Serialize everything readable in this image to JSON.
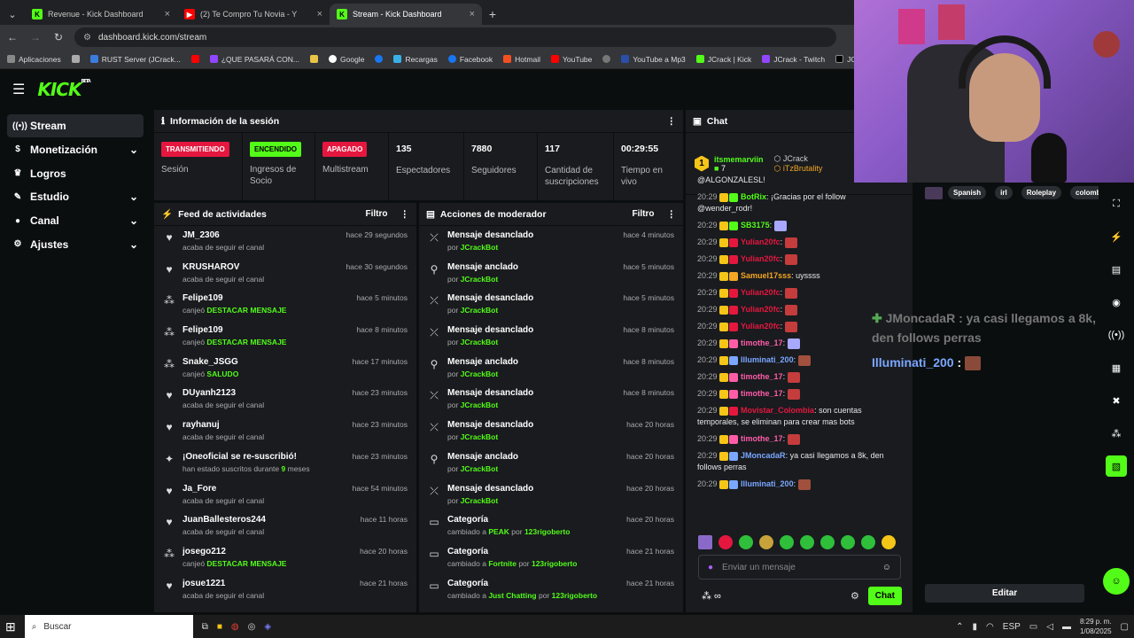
{
  "browser": {
    "tabs": [
      {
        "title": "Revenue - Kick Dashboard",
        "icon": "kick"
      },
      {
        "title": "(2) Te Compro Tu Novia - Y",
        "icon": "youtube"
      },
      {
        "title": "Stream - Kick Dashboard",
        "icon": "kick",
        "active": true
      }
    ],
    "url": "dashboard.kick.com/stream",
    "bookmarks": [
      "Aplicaciones",
      "RUST Server (JCrack...",
      "¿QUE PASARÁ CON...",
      "Google",
      "Recargas",
      "Facebook",
      "Hotmail",
      "YouTube",
      "YouTube a Mp3",
      "JCrack | Kick",
      "JCrack - Twitch",
      "JCrack (@J"
    ]
  },
  "logo": "KICK",
  "logo_sup": "BETA",
  "sidebar": {
    "items": [
      {
        "label": "Stream",
        "icon": "broadcast-icon",
        "active": true
      },
      {
        "label": "Monetización",
        "icon": "dollar-icon",
        "chevron": true
      },
      {
        "label": "Logros",
        "icon": "trophy-icon"
      },
      {
        "label": "Estudio",
        "icon": "pencil-icon",
        "chevron": true
      },
      {
        "label": "Canal",
        "icon": "user-icon",
        "chevron": true
      },
      {
        "label": "Ajustes",
        "icon": "gear-icon",
        "chevron": true
      }
    ]
  },
  "session": {
    "title": "Información de la sesión",
    "stats": [
      {
        "badge": "TRANSMITIENDO",
        "color": "red",
        "label": "Sesión"
      },
      {
        "badge": "ENCENDIDO",
        "color": "green",
        "label": "Ingresos de Socio"
      },
      {
        "badge": "APAGADO",
        "color": "red",
        "label": "Multistream"
      },
      {
        "value": "135",
        "label": "Espectadores"
      },
      {
        "value": "7880",
        "label": "Seguidores"
      },
      {
        "value": "117",
        "label": "Cantidad de suscripciones"
      },
      {
        "value": "00:29:55",
        "label": "Tiempo en vivo"
      }
    ]
  },
  "feed": {
    "title": "Feed de actividades",
    "filter": "Filtro",
    "items": [
      {
        "icon": "heart",
        "name": "JM_2306",
        "sub": "acaba de seguir el canal",
        "time": "hace 29 segundos"
      },
      {
        "icon": "heart",
        "name": "KRUSHAROV",
        "sub": "acaba de seguir el canal",
        "time": "hace 30 segundos"
      },
      {
        "icon": "points",
        "name": "Felipe109",
        "sub": "canjeó ",
        "hl": "DESTACAR MENSAJE",
        "time": "hace 5 minutos"
      },
      {
        "icon": "points",
        "name": "Felipe109",
        "sub": "canjeó ",
        "hl": "DESTACAR MENSAJE",
        "time": "hace 8 minutos"
      },
      {
        "icon": "points",
        "name": "Snake_JSGG",
        "sub": "canjeó ",
        "hl": "SALUDO",
        "time": "hace 17 minutos"
      },
      {
        "icon": "heart",
        "name": "DUyanh2123",
        "sub": "acaba de seguir el canal",
        "time": "hace 23 minutos"
      },
      {
        "icon": "heart",
        "name": "rayhanuj",
        "sub": "acaba de seguir el canal",
        "time": "hace 23 minutos"
      },
      {
        "icon": "star",
        "name": "¡Oneoficial se re-suscribió!",
        "sub": "han estado suscritos durante ",
        "hl": "9",
        "sub2": " meses",
        "time": "hace 23 minutos"
      },
      {
        "icon": "heart",
        "name": "Ja_Fore",
        "sub": "acaba de seguir el canal",
        "time": "hace 54 minutos"
      },
      {
        "icon": "heart",
        "name": "JuanBallesteros244",
        "sub": "acaba de seguir el canal",
        "time": "hace 11 horas"
      },
      {
        "icon": "points",
        "name": "josego212",
        "sub": "canjeó ",
        "hl": "DESTACAR MENSAJE",
        "time": "hace 20 horas"
      },
      {
        "icon": "heart",
        "name": "josue1221",
        "sub": "acaba de seguir el canal",
        "time": "hace 21 horas"
      }
    ]
  },
  "moderator": {
    "title": "Acciones de moderador",
    "filter": "Filtro",
    "items": [
      {
        "icon": "unpin",
        "name": "Mensaje desanclado",
        "sub": "por ",
        "hl": "JCrackBot",
        "time": "hace 4 minutos"
      },
      {
        "icon": "pin",
        "name": "Mensaje anclado",
        "sub": "por ",
        "hl": "JCrackBot",
        "time": "hace 5 minutos"
      },
      {
        "icon": "unpin",
        "name": "Mensaje desanclado",
        "sub": "por ",
        "hl": "JCrackBot",
        "time": "hace 5 minutos"
      },
      {
        "icon": "unpin",
        "name": "Mensaje desanclado",
        "sub": "por ",
        "hl": "JCrackBot",
        "time": "hace 8 minutos"
      },
      {
        "icon": "pin",
        "name": "Mensaje anclado",
        "sub": "por ",
        "hl": "JCrackBot",
        "time": "hace 8 minutos"
      },
      {
        "icon": "unpin",
        "name": "Mensaje desanclado",
        "sub": "por ",
        "hl": "JCrackBot",
        "time": "hace 8 minutos"
      },
      {
        "icon": "unpin",
        "name": "Mensaje desanclado",
        "sub": "por ",
        "hl": "JCrackBot",
        "time": "hace 20 horas"
      },
      {
        "icon": "pin",
        "name": "Mensaje anclado",
        "sub": "por ",
        "hl": "JCrackBot",
        "time": "hace 20 horas"
      },
      {
        "icon": "unpin",
        "name": "Mensaje desanclado",
        "sub": "por ",
        "hl": "JCrackBot",
        "time": "hace 20 horas"
      },
      {
        "icon": "category",
        "name": "Categoría",
        "sub": "cambiado a ",
        "hl": "PEAK",
        "sub2": " por ",
        "hl2": "123rigoberto",
        "time": "hace 20 horas"
      },
      {
        "icon": "category",
        "name": "Categoría",
        "sub": "cambiado a ",
        "hl": "Fortnite",
        "sub2": " por ",
        "hl2": "123rigoberto",
        "time": "hace 21 horas"
      },
      {
        "icon": "category",
        "name": "Categoría",
        "sub": "cambiado a ",
        "hl": "Just Chatting",
        "sub2": " por ",
        "hl2": "123rigoberto",
        "time": "hace 21 horas"
      }
    ]
  },
  "chat": {
    "title": "Chat",
    "pinned": {
      "rank": "1",
      "user": "itsmemarviin",
      "count": "7",
      "user2": "JCrack",
      "user3": "iTzBrutality"
    },
    "messages": [
      {
        "text": "@ALGONZALESL!"
      },
      {
        "time": "20:29",
        "user": "BotRix",
        "color": "#53fc18",
        "text": ": ¡Gracias por el follow @wender_rodr!"
      },
      {
        "time": "20:29",
        "user": "SB3175",
        "color": "#53fc18",
        "text": ":",
        "emote": "drop"
      },
      {
        "time": "20:29",
        "user": "Yulian20fc",
        "color": "#e5173f",
        "text": ":",
        "emote": "red"
      },
      {
        "time": "20:29",
        "user": "Yulian20fc",
        "color": "#e5173f",
        "text": ":",
        "emote": "red"
      },
      {
        "time": "20:29",
        "user": "Samuel17sss",
        "color": "#f5a623",
        "text": ": uyssss"
      },
      {
        "time": "20:29",
        "user": "Yulian20fc",
        "color": "#e5173f",
        "text": ":",
        "emote": "red"
      },
      {
        "time": "20:29",
        "user": "Yulian20fc",
        "color": "#e5173f",
        "text": ":",
        "emote": "red"
      },
      {
        "time": "20:29",
        "user": "Yulian20fc",
        "color": "#e5173f",
        "text": ":",
        "emote": "red"
      },
      {
        "time": "20:29",
        "user": "timothe_17",
        "color": "#ff5ca8",
        "text": ":",
        "emote": "drop"
      },
      {
        "time": "20:29",
        "user": "Illuminati_200",
        "color": "#7aa7ff",
        "text": ":",
        "emote": "face"
      },
      {
        "time": "20:29",
        "user": "timothe_17",
        "color": "#ff5ca8",
        "text": ":",
        "emote": "red"
      },
      {
        "time": "20:29",
        "user": "timothe_17",
        "color": "#ff5ca8",
        "text": ":",
        "emote": "red"
      },
      {
        "time": "20:29",
        "user": "Movistar_Colombia",
        "color": "#e5173f",
        "text": ": son cuentas temporales, se eliminan para crear mas bots"
      },
      {
        "time": "20:29",
        "user": "timothe_17",
        "color": "#ff5ca8",
        "text": ":",
        "emote": "red"
      },
      {
        "time": "20:29",
        "user": "JMoncadaR",
        "color": "#7aa7ff",
        "text": ": ya casi llegamos a 8k, den follows perras"
      },
      {
        "time": "20:29",
        "user": "Illuminati_200",
        "color": "#7aa7ff",
        "text": ":",
        "emote": "face"
      }
    ],
    "input_placeholder": "Enviar un mensaje",
    "send_label": "Chat"
  },
  "stream_tags": [
    "Spanish",
    "irl",
    "Roleplay",
    "colomb"
  ],
  "overlay": {
    "line1_user": "JMoncadaR",
    "line1_text": " : ya casi llegamos a 8k, den follows perras",
    "line2_user": "Illuminati_200",
    "line2_text": " :"
  },
  "edit_label": "Editar",
  "taskbar": {
    "search": "Buscar",
    "lang": "ESP",
    "time": "8:29 p. m.",
    "date": "1/08/2025"
  },
  "colors": {
    "accent": "#53fc18",
    "live": "#e5173f",
    "panel": "#191b1f",
    "bg": "#0b0e0f"
  }
}
